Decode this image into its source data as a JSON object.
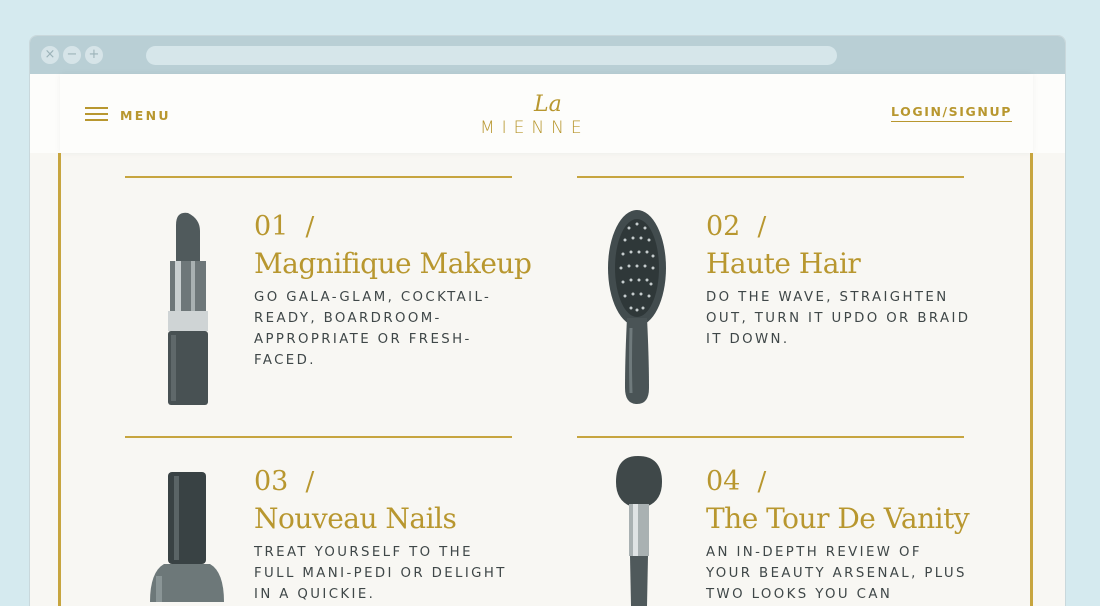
{
  "window": {
    "controls": [
      "×",
      "−",
      "+"
    ]
  },
  "header": {
    "menu_label": "MENU",
    "logo_script": "La",
    "logo_main": "MIENNE",
    "login_label": "LOGIN/SIGNUP"
  },
  "categories": [
    {
      "number": "01",
      "separator": "/",
      "title": "Magnifique Makeup",
      "description": "GO GALA-GLAM, COCKTAIL-READY, BOARDROOM-APPROPRIATE OR FRESH-FACED.",
      "icon": "lipstick-icon"
    },
    {
      "number": "02",
      "separator": "/",
      "title": "Haute Hair",
      "description": "DO THE WAVE, STRAIGHTEN OUT, TURN IT UPDO OR BRAID IT DOWN.",
      "icon": "hairbrush-icon"
    },
    {
      "number": "03",
      "separator": "/",
      "title": "Nouveau Nails",
      "description": "TREAT YOURSELF TO THE FULL MANI-PEDI OR DELIGHT IN A QUICKIE.",
      "icon": "nail-polish-icon"
    },
    {
      "number": "04",
      "separator": "/",
      "title": "The Tour De Vanity",
      "description": "AN IN-DEPTH REVIEW OF YOUR BEAUTY ARSENAL, PLUS TWO LOOKS YOU CAN RECREATE.",
      "icon": "makeup-brush-icon"
    }
  ],
  "colors": {
    "accent": "#b8972f",
    "rule": "#c7a53f",
    "background": "#d5eaef",
    "text": "#3f4748"
  }
}
